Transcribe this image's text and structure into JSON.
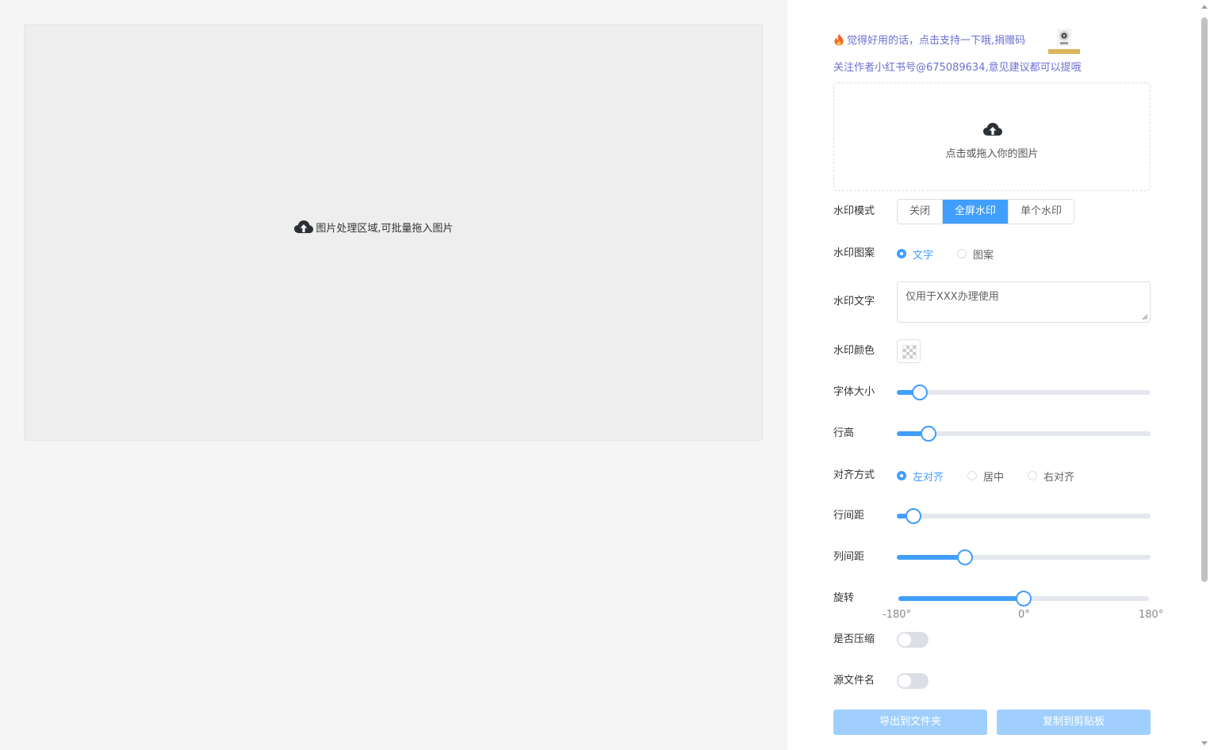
{
  "canvas": {
    "drop_text": "图片处理区域,可批量拖入图片",
    "icon": "cloud-upload-icon"
  },
  "panel": {
    "promo_text": "觉得好用的话，点击支持一下哦,捐赠码",
    "promo_icon": "fire-icon",
    "follow_text": "关注作者小红书号@675089634,意见建议都可以提哦",
    "upload_text": "点击或拖入你的图片",
    "accent_color": "#409eff",
    "link_color": "#6b6fd6"
  },
  "mode": {
    "label": "水印模式",
    "options": [
      "关闭",
      "全屏水印",
      "单个水印"
    ],
    "selected": "全屏水印"
  },
  "pattern": {
    "label": "水印图案",
    "options": [
      "文字",
      "图案"
    ],
    "selected": "文字"
  },
  "text": {
    "label": "水印文字",
    "value": "仅用于XXX办理使用"
  },
  "color": {
    "label": "水印颜色"
  },
  "font_size": {
    "label": "字体大小",
    "fraction": 0.09
  },
  "line_height": {
    "label": "行高",
    "fraction": 0.125
  },
  "align": {
    "label": "对齐方式",
    "options": [
      "左对齐",
      "居中",
      "右对齐"
    ],
    "selected": "左对齐"
  },
  "row_spacing": {
    "label": "行间距",
    "fraction": 0.065
  },
  "col_spacing": {
    "label": "列间距",
    "fraction": 0.27
  },
  "rotation": {
    "label": "旋转",
    "min_label": "-180°",
    "mid_label": "0°",
    "max_label": "180°",
    "value": 0
  },
  "compress": {
    "label": "是否压缩",
    "on": false
  },
  "source_name": {
    "label": "源文件名",
    "on": false
  },
  "buttons": {
    "export": "导出到文件夹",
    "copy": "复制到剪贴板"
  }
}
